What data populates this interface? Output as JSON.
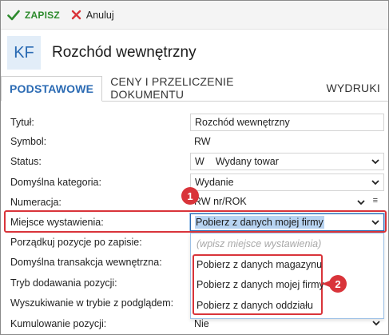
{
  "toolbar": {
    "save_label": "ZAPISZ",
    "cancel_label": "Anuluj"
  },
  "header": {
    "badge": "KF",
    "title": "Rozchód wewnętrzny"
  },
  "tabs": [
    {
      "label": "PODSTAWOWE"
    },
    {
      "label": "CENY I PRZELICZENIE DOKUMENTU"
    },
    {
      "label": "WYDRUKI"
    }
  ],
  "form": {
    "tytul": {
      "label": "Tytuł:",
      "value": "Rozchód wewnętrzny"
    },
    "symbol": {
      "label": "Symbol:",
      "value": "RW"
    },
    "status": {
      "label": "Status:",
      "code": "W",
      "value": "Wydany towar"
    },
    "kategoria": {
      "label": "Domyślna kategoria:",
      "value": "Wydanie"
    },
    "numeracja": {
      "label": "Numeracja:",
      "value": "RW nr/ROK",
      "menu": "≡"
    },
    "miejsce": {
      "label": "Miejsce wystawienia:",
      "value": "Pobierz z danych mojej firmy"
    },
    "porzadkuj": {
      "label": "Porządkuj pozycje po zapisie:"
    },
    "transakcja": {
      "label": "Domyślna transakcja wewnętrzna:"
    },
    "tryb": {
      "label": "Tryb dodawania pozycji:"
    },
    "wyszukiwanie": {
      "label": "Wyszukiwanie w trybie z podglądem:"
    },
    "kumulowanie": {
      "label": "Kumulowanie pozycji:",
      "value": "Nie"
    }
  },
  "dropdown": {
    "placeholder": "(wpisz miejsce wystawienia)",
    "options": [
      "Pobierz z danych magazynu",
      "Pobierz z danych mojej firmy",
      "Pobierz z danych oddziału"
    ]
  },
  "callouts": {
    "one": "1",
    "two": "2"
  },
  "colors": {
    "accent": "#2a6ab3",
    "save": "#2e8b2e",
    "cancel": "#d9343a",
    "highlight": "#d9343a"
  }
}
